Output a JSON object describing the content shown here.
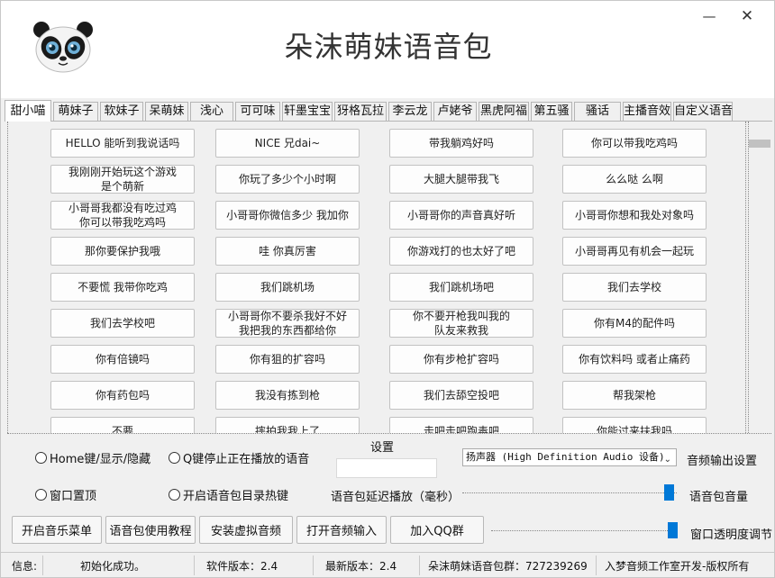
{
  "window": {
    "minimize_icon": "—",
    "close_icon": "✕"
  },
  "app": {
    "title": "朵沫萌妹语音包",
    "logo_icon": "panda-icon"
  },
  "tabs": [
    "甜小喵",
    "萌妹子",
    "软妹子",
    "呆萌妹",
    "浅心",
    "可可味",
    "轩墨宝宝",
    "犽格瓦拉",
    "李云龙",
    "卢姥爷",
    "黑虎阿福",
    "第五骚",
    "骚话",
    "主播音效",
    "自定义语音"
  ],
  "active_tab": "甜小喵",
  "sounds": [
    [
      "HELLO 能听到我说话吗",
      "NICE 兄dai~",
      "带我躺鸡好吗",
      "你可以带我吃鸡吗"
    ],
    [
      "我刚刚开始玩这个游戏\n是个萌新",
      "你玩了多少个小时啊",
      "大腿大腿带我飞",
      "么么哒 么啊"
    ],
    [
      "小哥哥我都没有吃过鸡\n你可以带我吃鸡吗",
      "小哥哥你微信多少 我加你",
      "小哥哥你的声音真好听",
      "小哥哥你想和我处对象吗"
    ],
    [
      "那你要保护我哦",
      "哇 你真厉害",
      "你游戏打的也太好了吧",
      "小哥哥再见有机会一起玩"
    ],
    [
      "不要慌 我带你吃鸡",
      "我们跳机场",
      "我们跳机场吧",
      "我们去学校"
    ],
    [
      "我们去学校吧",
      "小哥哥你不要杀我好不好\n我把我的东西都给你",
      "你不要开枪我叫我的\n队友来救我",
      "你有M4的配件吗"
    ],
    [
      "你有倍镜吗",
      "你有狙的扩容吗",
      "你有步枪扩容吗",
      "你有饮料吗 或者止痛药"
    ],
    [
      "你有药包吗",
      "我没有拣到枪",
      "我们去舔空投吧",
      "帮我架枪"
    ],
    [
      "不要",
      "摔拍我我上了",
      "走吧走吧跑毒吧",
      "你能过来扶我吗"
    ]
  ],
  "options": {
    "radio_home": "Home键/显示/隐藏",
    "radio_q": "Q键停止正在播放的语音",
    "radio_top": "窗口置顶",
    "radio_hotkey": "开启语音包目录热键",
    "settings_label": "设置",
    "audio_device": "扬声器 (High Definition Audio 设备)",
    "audio_output_label": "音频输出设置",
    "delay_label": "语音包延迟播放（毫秒）",
    "volume_label": "语音包音量",
    "opacity_label": "窗口透明度调节",
    "volume_level": 1.0,
    "opacity_level": 1.0
  },
  "buttons": [
    "开启音乐菜单",
    "语音包使用教程",
    "安装虚拟音频",
    "打开音频输入",
    "加入QQ群"
  ],
  "status": {
    "info_label": "信息:",
    "info_value": "初始化成功。",
    "version": "软件版本：2.4",
    "latest": "最新版本：2.4",
    "group": "朵沫萌妹语音包群：727239269",
    "copyright": "入梦音频工作室开发-版权所有"
  }
}
